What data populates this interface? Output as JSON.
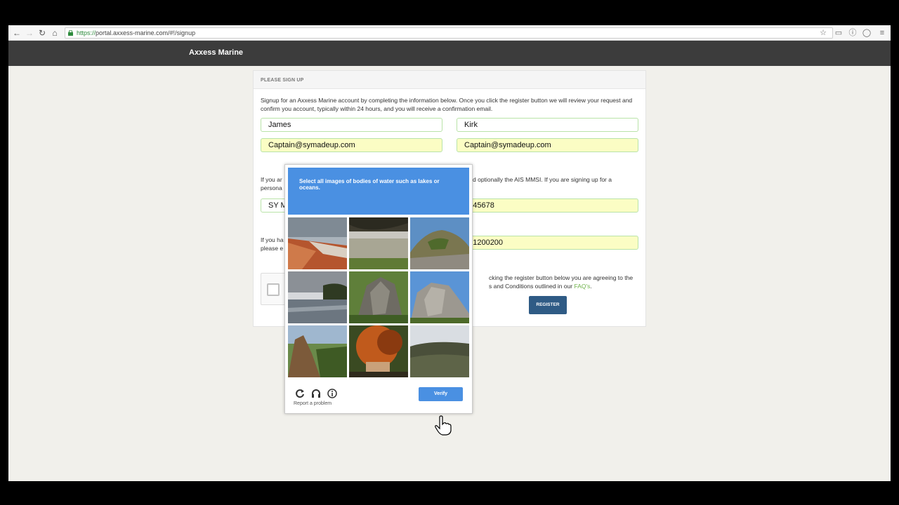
{
  "browser": {
    "url_scheme": "https://",
    "url_rest": "portal.axxess-marine.com/#!/signup",
    "back_icon": "arrow-left-icon",
    "forward_icon": "arrow-right-icon",
    "reload_icon": "reload-icon",
    "home_icon": "home-icon"
  },
  "site": {
    "brand": "Axxess Marine"
  },
  "panel": {
    "heading": "PLEASE SIGN UP",
    "intro": "Signup for an Axxess Marine account by completing the information below. Once you click the register button we will review your request and confirm you account, typically within 24 hours, and you will receive a confirmation email.",
    "first_name": "James",
    "last_name": "Kirk",
    "email": "Captain@symadeup.com",
    "email_confirm": "Captain@symadeup.com",
    "vessel_text_left": "If you ar",
    "vessel_text_left2": "persona",
    "vessel_text_right": "d optionally the AIS MMSI. If you are signing up for a",
    "vessel_name": "SY M",
    "mmsi": "2345678",
    "phone_text_left": "If you ha",
    "phone_text_left2": "please e",
    "phone": "M 1200200",
    "terms_text_1": "cking the register button below you are agreeing to the",
    "terms_text_2": "s and Conditions outlined in our",
    "terms_link": "FAQ's",
    "terms_end": ".",
    "register_label": "REGISTER"
  },
  "captcha": {
    "instruction": "Select all images of bodies of water such as lakes or oceans.",
    "report_label": "Report a problem",
    "verify_label": "Verify",
    "reload_icon": "reload-icon",
    "audio_icon": "headphones-icon",
    "info_icon": "info-icon",
    "tiles": [
      "red-rock-shore",
      "lake-with-tree",
      "rock-outcrop",
      "river-water",
      "rock-pile",
      "cliff-face",
      "rocky-peak",
      "autumn-tree",
      "forest-hills"
    ]
  },
  "colors": {
    "header_bg": "#3c3c3c",
    "accent_blue": "#4a90e2",
    "register_blue": "#2f5b85",
    "field_border": "#b9e3a8",
    "field_yellow": "#fbfdc4",
    "link_green": "#6fb34c"
  }
}
